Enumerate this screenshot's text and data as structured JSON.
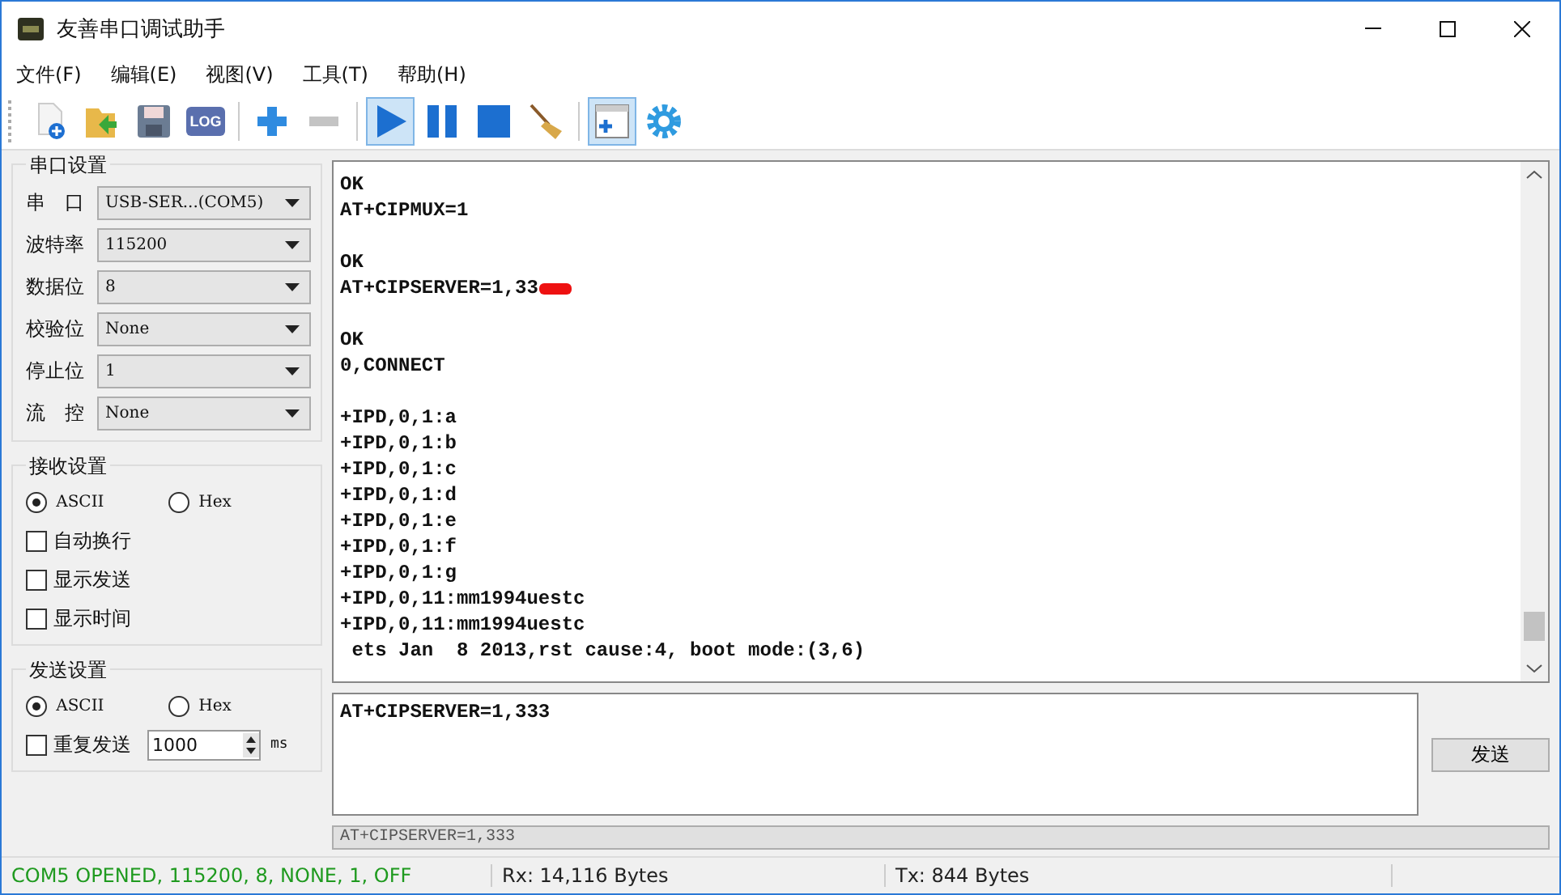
{
  "window": {
    "title": "友善串口调试助手"
  },
  "menu": [
    "文件(F)",
    "编辑(E)",
    "视图(V)",
    "工具(T)",
    "帮助(H)"
  ],
  "toolbar": [
    {
      "selected": false
    },
    {
      "selected": false
    },
    {
      "selected": false
    },
    {
      "selected": false
    },
    {
      "selected": false
    },
    {
      "selected": false
    },
    {
      "selected": true
    },
    {
      "selected": false
    },
    {
      "selected": false
    },
    {
      "selected": false
    },
    {
      "selected": true
    },
    {
      "selected": false
    }
  ],
  "toolbar_log_label": "LOG",
  "serial_settings": {
    "title": "串口设置",
    "fields": [
      {
        "label": "串　口",
        "value": "USB-SER...(COM5)"
      },
      {
        "label": "波特率",
        "value": "115200"
      },
      {
        "label": "数据位",
        "value": "8"
      },
      {
        "label": "校验位",
        "value": "None"
      },
      {
        "label": "停止位",
        "value": "1"
      },
      {
        "label": "流　控",
        "value": "None"
      }
    ]
  },
  "receive_settings": {
    "title": "接收设置",
    "radios": [
      {
        "label": "ASCII",
        "selected": true
      },
      {
        "label": "Hex",
        "selected": false
      }
    ],
    "checkboxes": [
      {
        "label": "自动换行",
        "checked": false
      },
      {
        "label": "显示发送",
        "checked": false
      },
      {
        "label": "显示时间",
        "checked": false
      }
    ]
  },
  "send_settings": {
    "title": "发送设置",
    "radios": [
      {
        "label": "ASCII",
        "selected": true
      },
      {
        "label": "Hex",
        "selected": false
      }
    ],
    "repeat": {
      "label": "重复发送",
      "checked": false
    },
    "interval": "1000",
    "unit": "ms"
  },
  "receive_log": [
    {
      "lines": [
        "OK",
        "AT+CIPMUX=1"
      ]
    },
    {
      "lines": [
        "OK",
        "AT+CIPSERVER=1,33"
      ],
      "redacted": true
    },
    {
      "lines": [
        "OK",
        "0,CONNECT"
      ]
    },
    {
      "lines": [
        "+IPD,0,1:a",
        "+IPD,0,1:b",
        "+IPD,0,1:c",
        "+IPD,0,1:d",
        "+IPD,0,1:e",
        "+IPD,0,1:f",
        "+IPD,0,1:g",
        "+IPD,0,11:mm1994uestc",
        "+IPD,0,11:mm1994uestc",
        " ets Jan  8 2013,rst cause:4, boot mode:(3,6)"
      ]
    }
  ],
  "send_input": {
    "value": "AT+CIPSERVER=1,333"
  },
  "send_button": "发送",
  "history": {
    "value": "AT+CIPSERVER=1,333"
  },
  "status_bar": [
    {
      "text": "COM5 OPENED, 115200, 8, NONE, 1, OFF",
      "color": "#1f9a1f"
    },
    {
      "text": "Rx: 14,116 Bytes",
      "color": "#222222"
    },
    {
      "text": "Tx: 844 Bytes",
      "color": "#222222"
    }
  ]
}
